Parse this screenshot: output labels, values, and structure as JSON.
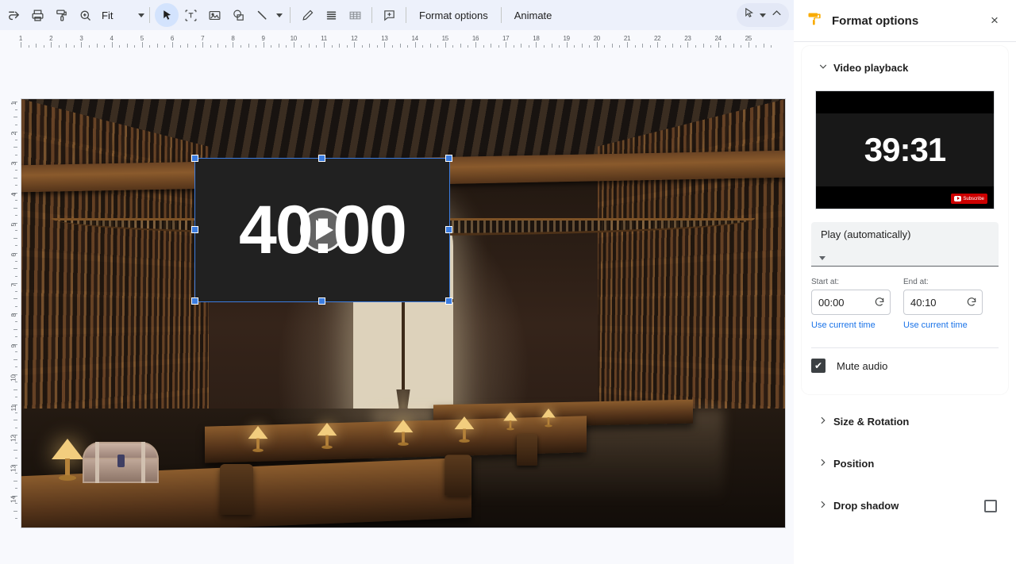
{
  "toolbar": {
    "tools": [
      {
        "name": "redo-icon",
        "label": "Redo"
      },
      {
        "name": "print-icon",
        "label": "Print"
      },
      {
        "name": "paint-format-icon",
        "label": "Paint format"
      },
      {
        "name": "zoom-icon",
        "label": "Zoom"
      }
    ],
    "zoom_value": "Fit",
    "insert_tools": [
      {
        "name": "select-tool",
        "label": "Select"
      },
      {
        "name": "text-box-tool",
        "label": "Text box"
      },
      {
        "name": "insert-image-tool",
        "label": "Insert image"
      },
      {
        "name": "shape-tool",
        "label": "Shape"
      },
      {
        "name": "line-tool",
        "label": "Line"
      },
      {
        "name": "curve-tool",
        "label": "Curve"
      },
      {
        "name": "text-align-tool",
        "label": "Text"
      },
      {
        "name": "table-tool",
        "label": "Table"
      },
      {
        "name": "comment-tool",
        "label": "Add comment"
      }
    ],
    "format_options_label": "Format options",
    "animate_label": "Animate",
    "right_tools": [
      {
        "name": "pointer-mode-icon",
        "label": "Pointer mode"
      },
      {
        "name": "collapse-chevron-icon",
        "label": "Hide the menus"
      }
    ]
  },
  "rulers": {
    "horizontal": [
      1,
      2,
      3,
      4,
      5,
      6,
      7,
      8,
      9,
      10,
      11,
      12,
      13,
      14,
      15,
      16,
      17,
      18,
      19,
      20,
      21,
      22,
      23,
      24,
      25
    ],
    "vertical": [
      1,
      2,
      3,
      4,
      5,
      6,
      7,
      8,
      9,
      10,
      11,
      12,
      13,
      14
    ]
  },
  "slide": {
    "background_alt": "Grand library interior with wooden bookshelves, arched window and table lamps",
    "video_object": {
      "display_time": "40:00",
      "play_icon": "play-icon",
      "selected": true
    }
  },
  "panel": {
    "icon": "paint-roller-icon",
    "title": "Format options",
    "close_label": "×",
    "video_playback": {
      "section_label": "Video playback",
      "expanded": true,
      "thumbnail_time": "39:31",
      "subscribe_label": "Subscribe",
      "play_mode": "Play (automatically)",
      "start": {
        "label": "Start at:",
        "value": "00:00",
        "reset_icon": "reset-icon",
        "link": "Use current time"
      },
      "end": {
        "label": "End at:",
        "value": "40:10",
        "reset_icon": "reset-icon",
        "link": "Use current time"
      },
      "mute": {
        "label": "Mute audio",
        "checked": true,
        "check_glyph": "✔"
      }
    },
    "sections": [
      {
        "label": "Size & Rotation",
        "expanded": false,
        "has_checkbox": false
      },
      {
        "label": "Position",
        "expanded": false,
        "has_checkbox": false
      },
      {
        "label": "Drop shadow",
        "expanded": false,
        "has_checkbox": true
      }
    ]
  },
  "colors": {
    "accent_blue": "#1a73e8",
    "selection_blue": "#3c7de0",
    "toolbar_bg": "#edf1fb",
    "panel_icon_orange": "#f9ab00",
    "subscribe_red": "#cc0000"
  }
}
